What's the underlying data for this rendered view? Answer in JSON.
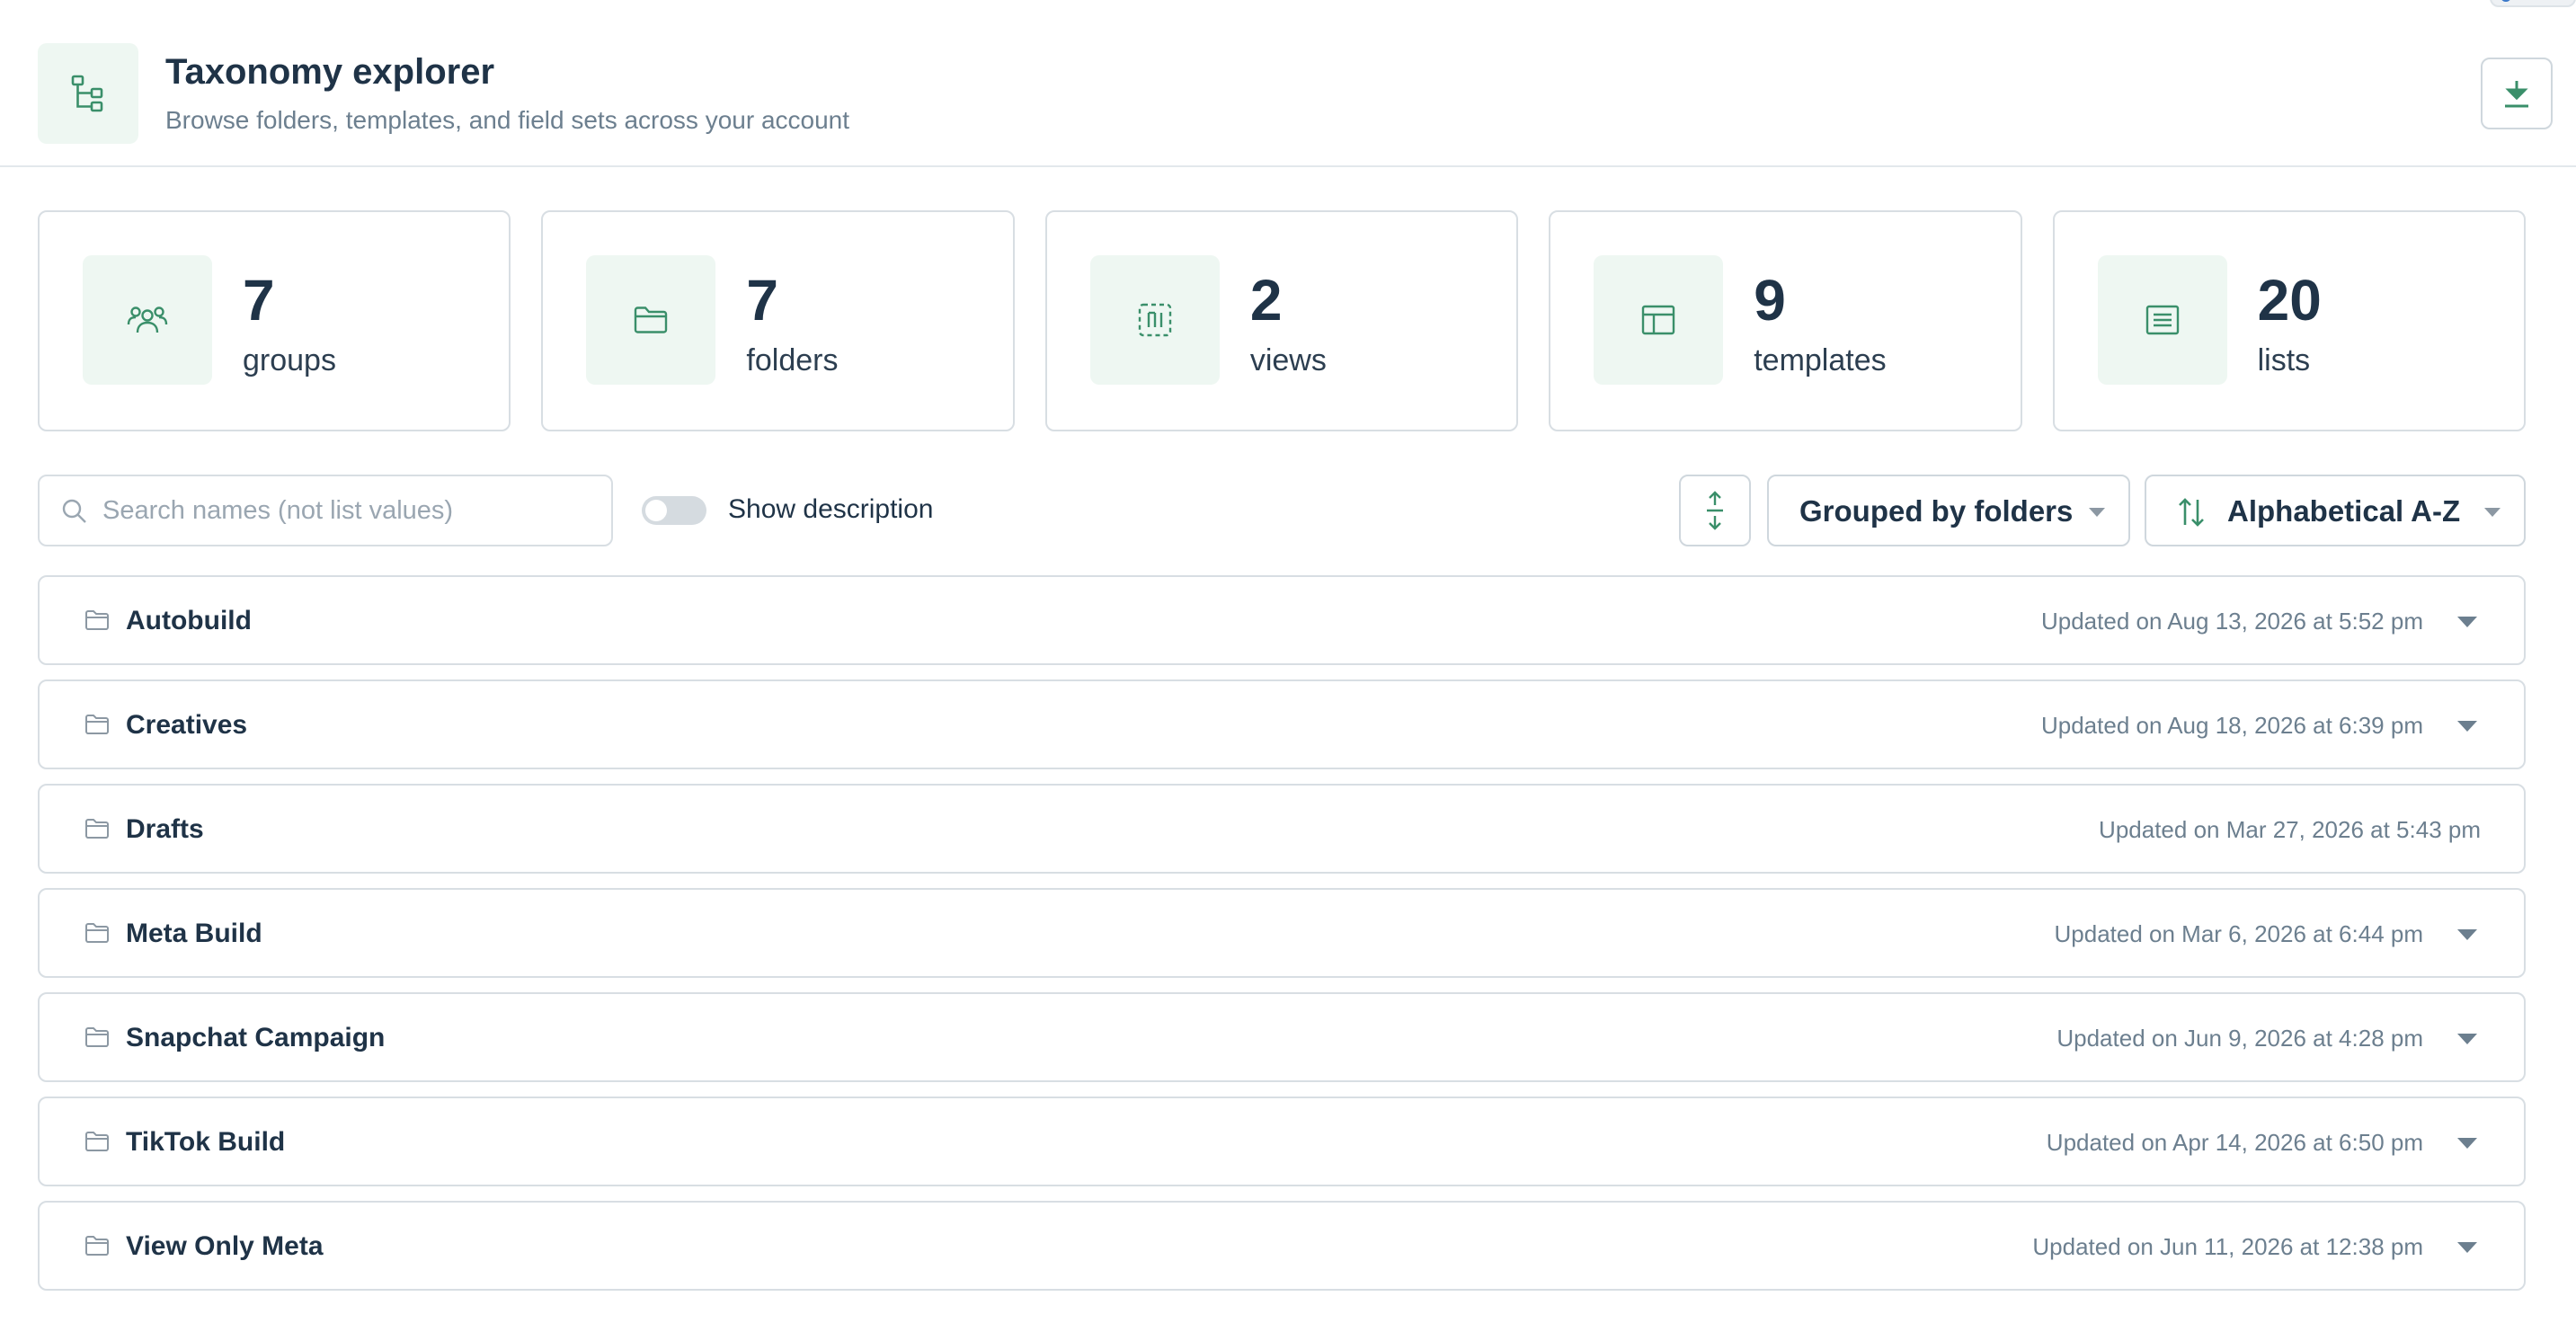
{
  "header": {
    "title": "Taxonomy explorer",
    "subtitle": "Browse folders, templates, and field sets across your account",
    "icon": "tree-icon",
    "download_icon": "download-icon"
  },
  "stats": [
    {
      "value": "7",
      "label": "groups",
      "icon": "groups-icon"
    },
    {
      "value": "7",
      "label": "folders",
      "icon": "folder-icon"
    },
    {
      "value": "2",
      "label": "views",
      "icon": "views-icon"
    },
    {
      "value": "9",
      "label": "templates",
      "icon": "template-icon"
    },
    {
      "value": "20",
      "label": "lists",
      "icon": "list-icon"
    }
  ],
  "toolbar": {
    "search_placeholder": "Search names (not list values)",
    "search_value": "",
    "show_description_label": "Show description",
    "show_description_on": false,
    "grouping_label": "Grouped by folders",
    "sort_label": "Alphabetical A-Z"
  },
  "folders": [
    {
      "name": "Autobuild",
      "updated": "Updated on Aug 13, 2026 at 5:52 pm",
      "expandable": true
    },
    {
      "name": "Creatives",
      "updated": "Updated on Aug 18, 2026 at 6:39 pm",
      "expandable": true
    },
    {
      "name": "Drafts",
      "updated": "Updated on Mar 27, 2026 at 5:43 pm",
      "expandable": false
    },
    {
      "name": "Meta Build",
      "updated": "Updated on Mar 6, 2026 at 6:44 pm",
      "expandable": true
    },
    {
      "name": "Snapchat Campaign",
      "updated": "Updated on Jun 9, 2026 at 4:28 pm",
      "expandable": true
    },
    {
      "name": "TikTok Build",
      "updated": "Updated on Apr 14, 2026 at 6:50 pm",
      "expandable": true
    },
    {
      "name": "View Only Meta",
      "updated": "Updated on Jun 11, 2026 at 12:38 pm",
      "expandable": true
    }
  ],
  "colors": {
    "accent": "#3a8f6a",
    "accent_bg": "#eef7f2",
    "border": "#d8dee3",
    "text": "#1f3347",
    "muted": "#6c7f8f"
  }
}
